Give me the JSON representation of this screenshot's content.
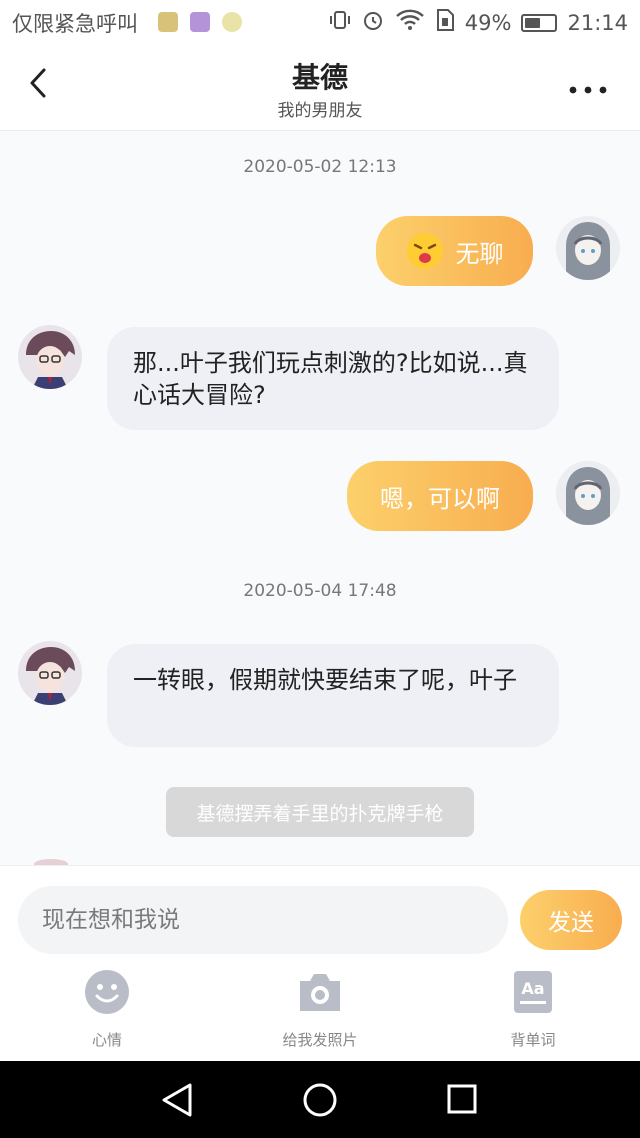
{
  "status_bar": {
    "carrier": "仅限紧急呼叫",
    "battery": "49%",
    "battery_level": 0.49,
    "time": "21:14"
  },
  "header": {
    "title": "基德",
    "subtitle": "我的男朋友"
  },
  "messages": {
    "time1": "2020-05-02  12:13",
    "me1": "无聊",
    "him1": "那...叶子我们玩点刺激的?比如说...真心话大冒险?",
    "me2": "嗯，可以啊",
    "time2": "2020-05-04  17:48",
    "him2": "一转眼，假期就快要结束了呢，叶子",
    "system": "基德摆弄着手里的扑克牌手枪"
  },
  "input": {
    "placeholder": "现在想和我说",
    "send_label": "发送"
  },
  "tools": {
    "mood": "心情",
    "photo": "给我发照片",
    "words": "背单词"
  },
  "colors": {
    "accent_start": "#fcd06c",
    "accent_end": "#f8ad4f",
    "bubble_other": "#eef0f5",
    "tool_icon": "#b9bdc7"
  }
}
